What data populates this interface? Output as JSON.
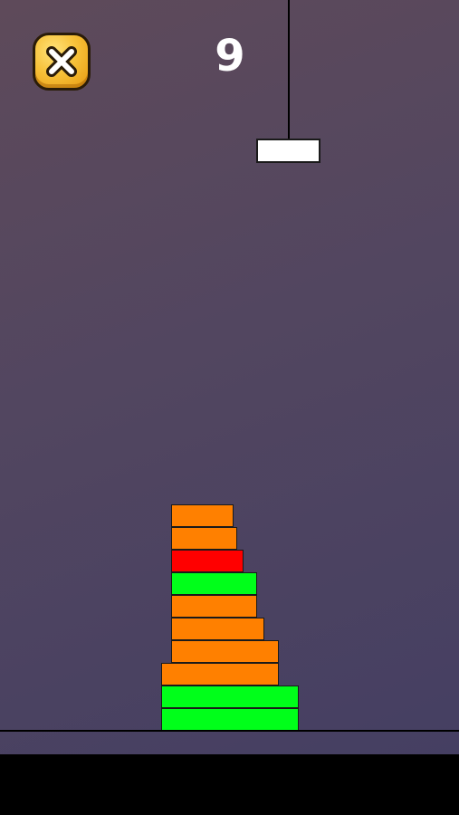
{
  "hud": {
    "score": "9",
    "close_icon": "close-x-icon"
  },
  "hanging_block": {
    "color": "#ffffff"
  },
  "tower": {
    "colors": {
      "perfect": "#00ff1a",
      "good": "#ff8000",
      "bad": "#ff0000"
    },
    "blocks": [
      {
        "quality": "perfect"
      },
      {
        "quality": "perfect"
      },
      {
        "quality": "good"
      },
      {
        "quality": "good"
      },
      {
        "quality": "good"
      },
      {
        "quality": "good"
      },
      {
        "quality": "perfect"
      },
      {
        "quality": "bad"
      },
      {
        "quality": "good"
      },
      {
        "quality": "good"
      }
    ]
  }
}
